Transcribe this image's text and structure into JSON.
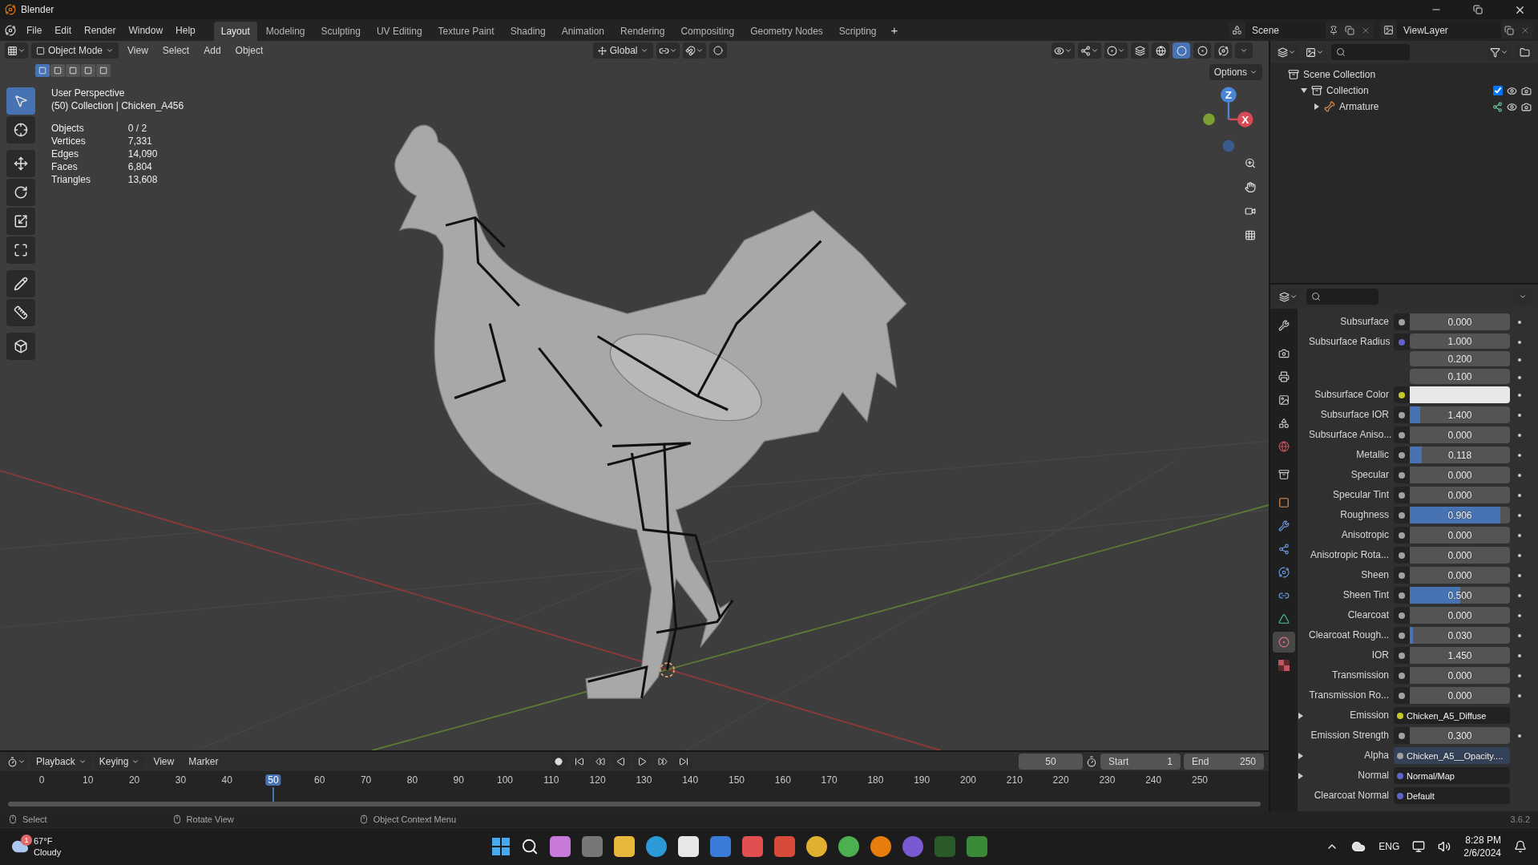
{
  "window": {
    "title": "Blender"
  },
  "menu": [
    "File",
    "Edit",
    "Render",
    "Window",
    "Help"
  ],
  "workspaces": [
    {
      "label": "Layout",
      "selected": true
    },
    {
      "label": "Modeling",
      "selected": false
    },
    {
      "label": "Sculpting",
      "selected": false
    },
    {
      "label": "UV Editing",
      "selected": false
    },
    {
      "label": "Texture Paint",
      "selected": false
    },
    {
      "label": "Shading",
      "selected": false
    },
    {
      "label": "Animation",
      "selected": false
    },
    {
      "label": "Rendering",
      "selected": false
    },
    {
      "label": "Compositing",
      "selected": false
    },
    {
      "label": "Geometry Nodes",
      "selected": false
    },
    {
      "label": "Scripting",
      "selected": false
    }
  ],
  "add_workspace": "+",
  "scene": {
    "name": "Scene",
    "view_layer": "ViewLayer"
  },
  "viewport": {
    "mode": "Object Mode",
    "menus": [
      "View",
      "Select",
      "Add",
      "Object"
    ],
    "orientation": "Global",
    "options": "Options",
    "select_modes": [
      {
        "selected": true
      },
      {
        "selected": false
      },
      {
        "selected": false
      },
      {
        "selected": false
      },
      {
        "selected": false
      }
    ],
    "shading_modes": [
      {
        "kind": "wireframe",
        "selected": false
      },
      {
        "kind": "solid",
        "selected": true
      },
      {
        "kind": "material",
        "selected": false
      },
      {
        "kind": "rendered",
        "selected": false
      }
    ],
    "tools": [
      {
        "kind": "select",
        "selected": true
      },
      {
        "kind": "cursor",
        "selected": false
      },
      {
        "kind": "move",
        "selected": false
      },
      {
        "kind": "rotate",
        "selected": false
      },
      {
        "kind": "scale",
        "selected": false
      },
      {
        "kind": "transform",
        "selected": false
      },
      {
        "kind": "annotate",
        "selected": false
      },
      {
        "kind": "measure",
        "selected": false
      },
      {
        "kind": "add-cube",
        "selected": false
      }
    ],
    "view_name": "User Perspective",
    "context": "(50) Collection | Chicken_A456",
    "stats": [
      {
        "label": "Objects",
        "value": "0 / 2"
      },
      {
        "label": "Vertices",
        "value": "7,331"
      },
      {
        "label": "Edges",
        "value": "14,090"
      },
      {
        "label": "Faces",
        "value": "6,804"
      },
      {
        "label": "Triangles",
        "value": "13,608"
      }
    ],
    "gizmo": {
      "z": "Z",
      "x": "X"
    }
  },
  "outliner": {
    "items": [
      {
        "name": "Scene Collection",
        "kind": "scene",
        "children": [
          {
            "name": "Collection",
            "kind": "collection",
            "expanded": true,
            "checked": true,
            "children": [
              {
                "name": "Armature",
                "kind": "armature",
                "expanded": false
              }
            ]
          }
        ]
      }
    ]
  },
  "properties": {
    "tabs": [
      {
        "kind": "tool",
        "selected": false
      },
      {
        "kind": "render",
        "selected": false
      },
      {
        "kind": "output",
        "selected": false
      },
      {
        "kind": "view-layer",
        "selected": false
      },
      {
        "kind": "scene",
        "selected": false
      },
      {
        "kind": "world",
        "selected": false
      },
      {
        "kind": "collection",
        "selected": false
      },
      {
        "kind": "object",
        "selected": false
      },
      {
        "kind": "modifier",
        "selected": false
      },
      {
        "kind": "particles",
        "selected": false
      },
      {
        "kind": "physics",
        "selected": false
      },
      {
        "kind": "constraints",
        "selected": false
      },
      {
        "kind": "data",
        "selected": false
      },
      {
        "kind": "material",
        "selected": true
      },
      {
        "kind": "texture",
        "selected": false
      }
    ],
    "rows": [
      {
        "kind": "slider",
        "label": "Subsurface",
        "color": "#a1a1a1",
        "value": "0.000"
      },
      {
        "kind": "vector",
        "label": "Subsurface Radius",
        "color": "#6363c7",
        "values": [
          "1.000",
          "0.200",
          "0.100"
        ]
      },
      {
        "kind": "color",
        "label": "Subsurface Color",
        "color": "#c7c729",
        "value": {
          "color": "#e8e8e8"
        }
      },
      {
        "kind": "slider",
        "label": "Subsurface IOR",
        "color": "#a1a1a1",
        "value": "1.400",
        "level": 0.1
      },
      {
        "kind": "slider",
        "label": "Subsurface Aniso...",
        "color": "#a1a1a1",
        "value": "0.000"
      },
      {
        "kind": "slider",
        "label": "Metallic",
        "color": "#a1a1a1",
        "value": "0.118",
        "level": 0.118
      },
      {
        "kind": "slider",
        "label": "Specular",
        "color": "#a1a1a1",
        "value": "0.000"
      },
      {
        "kind": "slider",
        "label": "Specular Tint",
        "color": "#a1a1a1",
        "value": "0.000"
      },
      {
        "kind": "slider",
        "label": "Roughness",
        "color": "#a1a1a1",
        "value": "0.906",
        "level": 0.906
      },
      {
        "kind": "slider",
        "label": "Anisotropic",
        "color": "#a1a1a1",
        "value": "0.000"
      },
      {
        "kind": "slider",
        "label": "Anisotropic Rota...",
        "color": "#a1a1a1",
        "value": "0.000"
      },
      {
        "kind": "slider",
        "label": "Sheen",
        "color": "#a1a1a1",
        "value": "0.000"
      },
      {
        "kind": "slider",
        "label": "Sheen Tint",
        "color": "#a1a1a1",
        "value": "0.500",
        "level": 0.5
      },
      {
        "kind": "slider",
        "label": "Clearcoat",
        "color": "#a1a1a1",
        "value": "0.000"
      },
      {
        "kind": "slider",
        "label": "Clearcoat Rough...",
        "color": "#a1a1a1",
        "value": "0.030",
        "level": 0.03
      },
      {
        "kind": "number",
        "label": "IOR",
        "color": "#a1a1a1",
        "value": "1.450"
      },
      {
        "kind": "slider",
        "label": "Transmission",
        "color": "#a1a1a1",
        "value": "0.000"
      },
      {
        "kind": "slider",
        "label": "Transmission Ro...",
        "color": "#a1a1a1",
        "value": "0.000"
      },
      {
        "kind": "link",
        "label": "Emission",
        "color": "#c7c729",
        "value": "Chicken_A5_Diffuse",
        "expandable": true,
        "highlighted": false
      },
      {
        "kind": "number",
        "label": "Emission Strength",
        "color": "#a1a1a1",
        "value": "0.300"
      },
      {
        "kind": "link",
        "label": "Alpha",
        "color": "#a1a1a1",
        "value": "Chicken_A5__Opacity....",
        "expandable": true,
        "highlighted": true
      },
      {
        "kind": "link",
        "label": "Normal",
        "color": "#6363c7",
        "value": "Normal/Map",
        "expandable": true,
        "highlighted": false
      },
      {
        "kind": "link",
        "label": "Clearcoat Normal",
        "color": "#6363c7",
        "value": "Default",
        "highlighted": false
      }
    ]
  },
  "timeline": {
    "menus": [
      "Playback",
      "Keying",
      "View",
      "Marker"
    ],
    "current_frame": "50",
    "start_label": "Start",
    "start": "1",
    "end_label": "End",
    "end": "250",
    "ruler": [
      {
        "label": "0",
        "selected": false
      },
      {
        "label": "10",
        "selected": false
      },
      {
        "label": "20",
        "selected": false
      },
      {
        "label": "30",
        "selected": false
      },
      {
        "label": "40",
        "selected": false
      },
      {
        "label": "50",
        "selected": true
      },
      {
        "label": "60",
        "selected": false
      },
      {
        "label": "70",
        "selected": false
      },
      {
        "label": "80",
        "selected": false
      },
      {
        "label": "90",
        "selected": false
      },
      {
        "label": "100",
        "selected": false
      },
      {
        "label": "110",
        "selected": false
      },
      {
        "label": "120",
        "selected": false
      },
      {
        "label": "130",
        "selected": false
      },
      {
        "label": "140",
        "selected": false
      },
      {
        "label": "150",
        "selected": false
      },
      {
        "label": "160",
        "selected": false
      },
      {
        "label": "170",
        "selected": false
      },
      {
        "label": "180",
        "selected": false
      },
      {
        "label": "190",
        "selected": false
      },
      {
        "label": "200",
        "selected": false
      },
      {
        "label": "210",
        "selected": false
      },
      {
        "label": "220",
        "selected": false
      },
      {
        "label": "230",
        "selected": false
      },
      {
        "label": "240",
        "selected": false
      },
      {
        "label": "250",
        "selected": false
      }
    ]
  },
  "status_bar": {
    "hints": [
      "Select",
      "Rotate View",
      "Object Context Menu"
    ],
    "version": "3.6.2"
  },
  "taskbar": {
    "weather": {
      "badge": "1",
      "temperature": "67°F",
      "condition": "Cloudy"
    },
    "language": "ENG",
    "time": "8:28 PM",
    "date": "2/6/2024"
  }
}
